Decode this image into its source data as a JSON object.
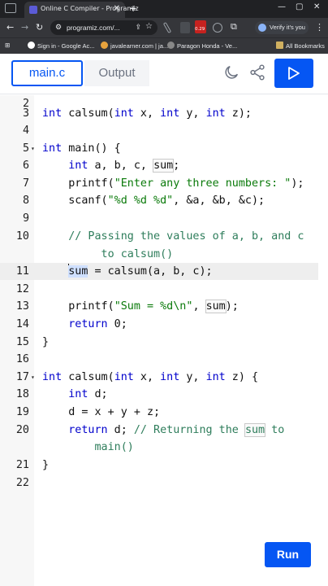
{
  "browser": {
    "tab_title": "Online C Compiler - Programiz",
    "url": "programiz.com/...",
    "verify_label": "Verify it's you",
    "bookmarks": [
      "Sign in - Google Ac...",
      "javalearner.com | ja...",
      "Paragon Honda - Ve...",
      "All Bookmarks"
    ],
    "badge_text": "0.29"
  },
  "app": {
    "file_tab": "main.c",
    "output_tab": "Output",
    "run_label": "Run",
    "accent": "#0556f3"
  },
  "editor": {
    "active_line": 11,
    "cursor_position": "line 11, column 1",
    "lines": [
      {
        "n": "2",
        "text": ""
      },
      {
        "n": "3",
        "text": "int calsum(int x, int y, int z);"
      },
      {
        "n": "4",
        "text": ""
      },
      {
        "n": "5",
        "text": "int main() {"
      },
      {
        "n": "6",
        "text": "    int a, b, c, sum;"
      },
      {
        "n": "7",
        "text": "    printf(\"Enter any three numbers: \");"
      },
      {
        "n": "8",
        "text": "    scanf(\"%d %d %d\", &a, &b, &c);"
      },
      {
        "n": "9",
        "text": ""
      },
      {
        "n": "10",
        "text": "    // Passing the values of a, b, and c"
      },
      {
        "n": "",
        "text": "         to calsum()"
      },
      {
        "n": "11",
        "text": "    sum = calsum(a, b, c);"
      },
      {
        "n": "12",
        "text": ""
      },
      {
        "n": "13",
        "text": "    printf(\"Sum = %d\\n\", sum);"
      },
      {
        "n": "14",
        "text": "    return 0;"
      },
      {
        "n": "15",
        "text": "}"
      },
      {
        "n": "16",
        "text": ""
      },
      {
        "n": "17",
        "text": "int calsum(int x, int y, int z) {"
      },
      {
        "n": "18",
        "text": "    int d;"
      },
      {
        "n": "19",
        "text": "    d = x + y + z;"
      },
      {
        "n": "20",
        "text": "    return d; // Returning the sum to"
      },
      {
        "n": "",
        "text": "        main()"
      },
      {
        "n": "21",
        "text": "}"
      },
      {
        "n": "22",
        "text": ""
      }
    ]
  },
  "icons": [
    "back-icon",
    "forward-icon",
    "reload-icon",
    "site-info-icon",
    "share-icon",
    "star-icon",
    "extension-icon",
    "moon-icon",
    "share-nodes-icon",
    "play-icon",
    "fold-arrow-icon"
  ]
}
